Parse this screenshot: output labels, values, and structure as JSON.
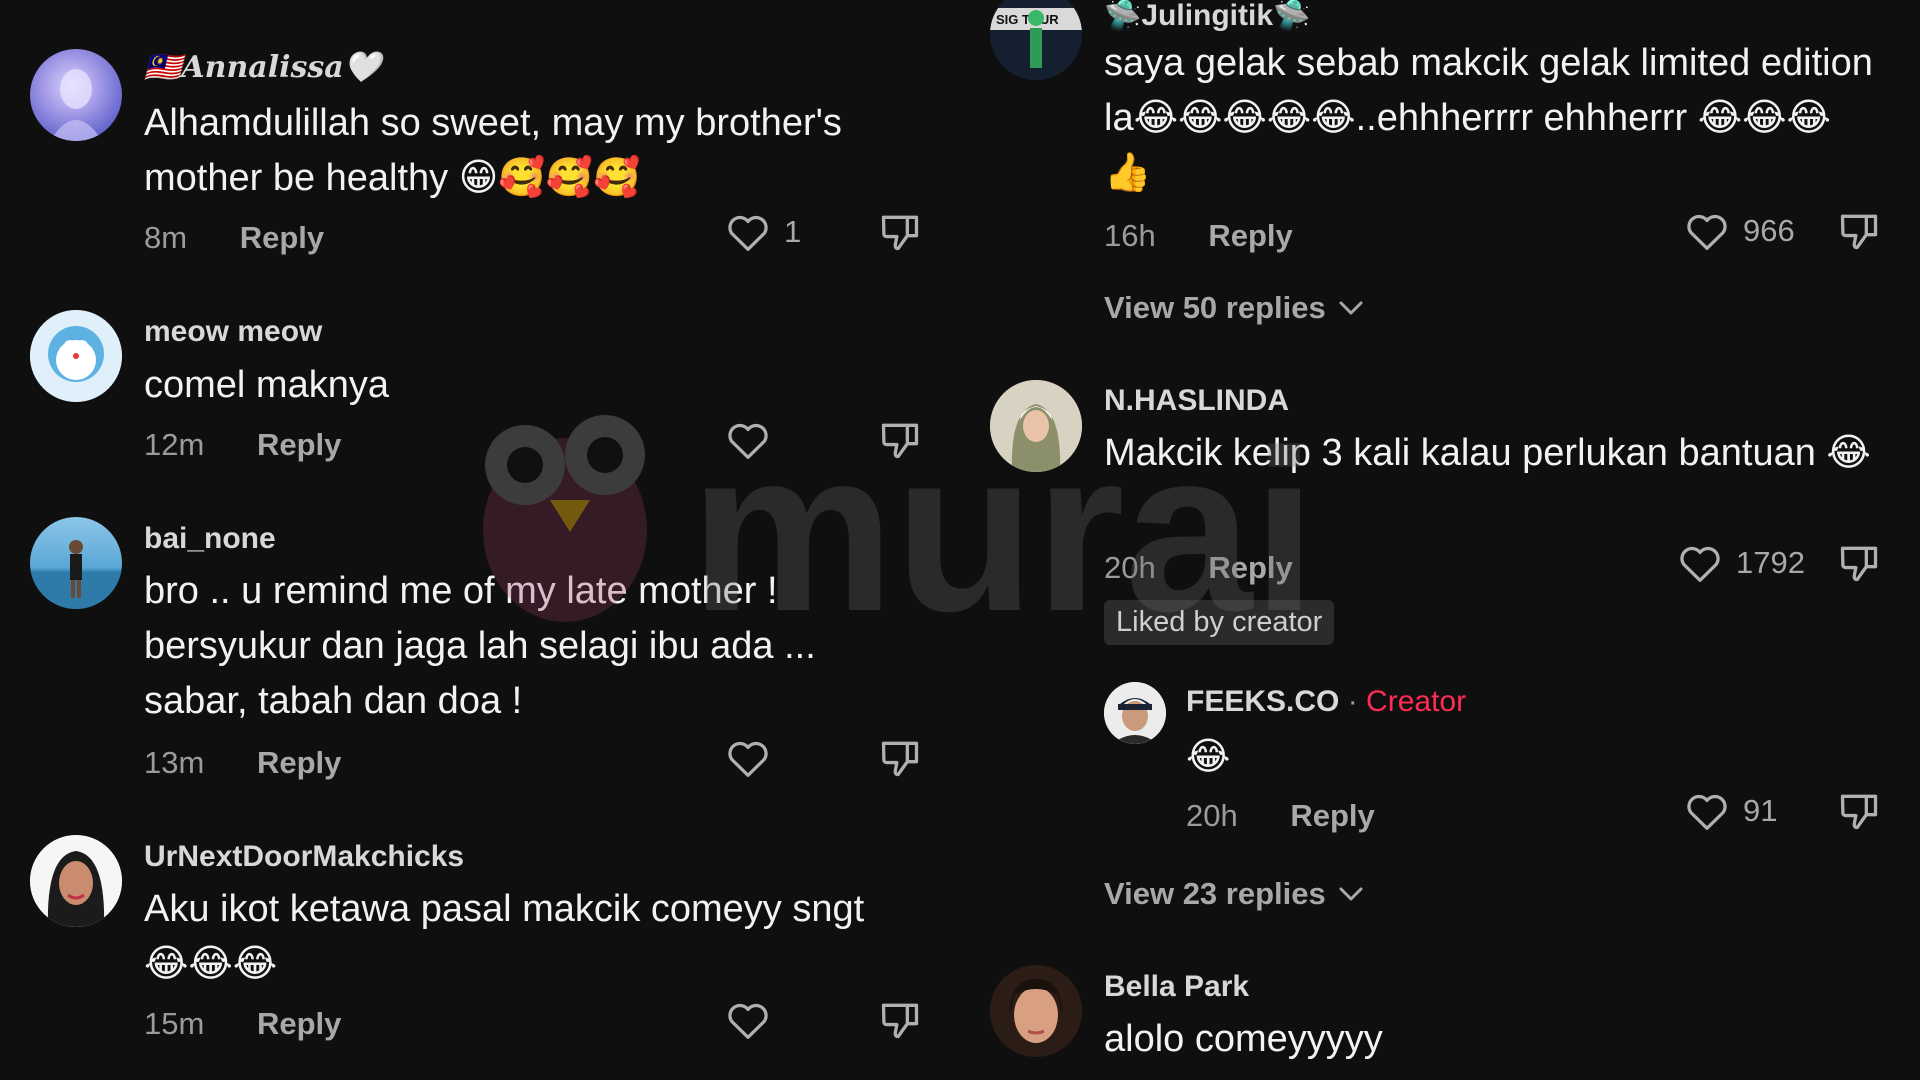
{
  "watermark": {
    "text": "murai"
  },
  "left": {
    "comments": [
      {
        "username": "🇲🇾𝑨𝒏𝒏𝒂𝒍𝒊𝒔𝒔𝒂🤍",
        "text": "Alhamdulillah so sweet, may my brother's mother be healthy 😁🥰🥰🥰",
        "time": "8m",
        "reply": "Reply",
        "likes": "1"
      },
      {
        "username": "meow meow",
        "text": "comel maknya",
        "time": "12m",
        "reply": "Reply",
        "likes": ""
      },
      {
        "username": "bai_none",
        "text": "bro .. u remind me of my late mother ! bersyukur dan jaga lah selagi ibu ada ... sabar, tabah dan doa !",
        "time": "13m",
        "reply": "Reply",
        "likes": ""
      },
      {
        "username": "UrNextDoorMakchicks",
        "text": "Aku ikot ketawa pasal makcik comeyy sngt 😂😂😂",
        "time": "15m",
        "reply": "Reply",
        "likes": ""
      }
    ]
  },
  "right": {
    "comments": [
      {
        "username": "🛸Julingitik🛸",
        "avatar_text": "SIG  TOUR",
        "text": "saya gelak sebab makcik gelak limited edition la😂😂😂😂😂..ehhherrrr ehhherrr 😂😂😂👍",
        "time": "16h",
        "reply": "Reply",
        "likes": "966",
        "view_replies": "View 50 replies"
      },
      {
        "username": "N.HASLINDA",
        "text": "Makcik kelip 3 kali kalau perlukan bantuan 😂",
        "time": "20h",
        "reply": "Reply",
        "likes": "1792",
        "liked_by": "Liked by creator"
      },
      {
        "username": "FEEKS.CO",
        "creator_sep": "·",
        "creator_tag": "Creator",
        "text": "😂",
        "time": "20h",
        "reply": "Reply",
        "likes": "91",
        "view_replies": "View 23 replies"
      },
      {
        "username": "Bella Park",
        "text": "alolo comeyyyyy"
      }
    ]
  },
  "colors": {
    "background": "#0f0f0f",
    "creator": "#fe2c55",
    "muted": "#a8a8a8"
  },
  "icons": [
    "heart-icon",
    "thumbs-down-icon",
    "chevron-down-icon"
  ]
}
